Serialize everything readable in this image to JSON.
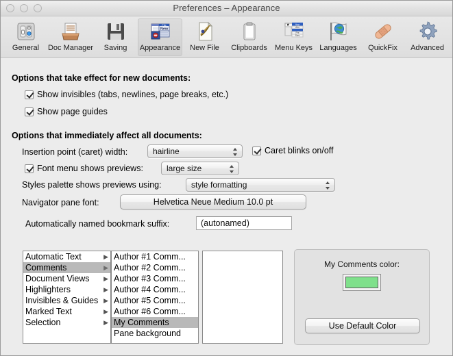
{
  "window": {
    "title": "Preferences – Appearance",
    "traffic_lights": [
      "close",
      "minimize",
      "zoom"
    ]
  },
  "toolbar": {
    "items": [
      {
        "label": "General",
        "icon": "sliders-icon",
        "selected": false
      },
      {
        "label": "Doc Manager",
        "icon": "inbox-tray-icon",
        "selected": false
      },
      {
        "label": "Saving",
        "icon": "floppy-disk-icon",
        "selected": false
      },
      {
        "label": "Appearance",
        "icon": "windows-file-new-icon",
        "selected": true
      },
      {
        "label": "New File",
        "icon": "document-quill-icon",
        "selected": false
      },
      {
        "label": "Clipboards",
        "icon": "clipboard-icon",
        "selected": false
      },
      {
        "label": "Menu Keys",
        "icon": "menu-keys-icon",
        "selected": false
      },
      {
        "label": "Languages",
        "icon": "globe-flag-icon",
        "selected": false
      },
      {
        "label": "QuickFix",
        "icon": "bandage-icon",
        "selected": false
      },
      {
        "label": "Advanced",
        "icon": "gear-icon",
        "selected": false
      }
    ]
  },
  "sections": {
    "new_documents_heading": "Options that take effect for new documents:",
    "all_documents_heading": "Options that immediately affect all documents:"
  },
  "checkboxes": {
    "show_invisibles": {
      "label": "Show invisibles (tabs, newlines, page breaks, etc.)",
      "checked": true
    },
    "show_page_guides": {
      "label": "Show page guides",
      "checked": true
    },
    "caret_blinks": {
      "label": "Caret blinks on/off",
      "checked": true
    },
    "font_menu_previews": {
      "label": "Font menu shows previews:",
      "checked": true
    }
  },
  "fields": {
    "caret_width_label": "Insertion point (caret) width:",
    "caret_width_value": "hairline",
    "font_menu_preview_value": "large size",
    "styles_palette_label": "Styles palette shows previews using:",
    "styles_palette_value": "style formatting",
    "navigator_font_label": "Navigator pane font:",
    "navigator_font_value": "Helvetica Neue Medium 10.0 pt",
    "bookmark_suffix_label": "Automatically named bookmark suffix:",
    "bookmark_suffix_value": "(autonamed)"
  },
  "lists": {
    "categories": [
      {
        "label": "Automatic Text",
        "has_submenu": true,
        "selected": false
      },
      {
        "label": "Comments",
        "has_submenu": true,
        "selected": true
      },
      {
        "label": "Document Views",
        "has_submenu": true,
        "selected": false
      },
      {
        "label": "Highlighters",
        "has_submenu": true,
        "selected": false
      },
      {
        "label": "Invisibles & Guides",
        "has_submenu": true,
        "selected": false
      },
      {
        "label": "Marked Text",
        "has_submenu": true,
        "selected": false
      },
      {
        "label": "Selection",
        "has_submenu": true,
        "selected": false
      }
    ],
    "items": [
      {
        "label": "Author #1 Comm...",
        "selected": false
      },
      {
        "label": "Author #2 Comm...",
        "selected": false
      },
      {
        "label": "Author #3 Comm...",
        "selected": false
      },
      {
        "label": "Author #4 Comm...",
        "selected": false
      },
      {
        "label": "Author #5 Comm...",
        "selected": false
      },
      {
        "label": "Author #6 Comm...",
        "selected": false
      },
      {
        "label": "My Comments",
        "selected": true
      },
      {
        "label": "Pane background",
        "selected": false
      }
    ],
    "detail": []
  },
  "color_panel": {
    "title": "My Comments color:",
    "swatch_color": "#7fe08b",
    "default_button_label": "Use Default Color"
  }
}
